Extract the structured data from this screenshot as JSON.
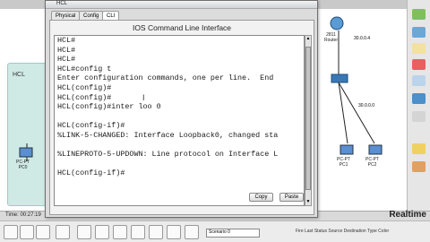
{
  "window": {
    "title": "HCL",
    "tabs": [
      "Physical",
      "Config",
      "CLI"
    ],
    "active_tab": "CLI",
    "cli_title": "IOS Command Line Interface",
    "terminal_lines": [
      "HCL#",
      "HCL#",
      "HCL#",
      "HCL#config t",
      "Enter configuration commands, one per line.  End",
      "HCL(config)#",
      "HCL(config)#",
      "HCL(config)#inter loo 0",
      "",
      "HCL(config-if)#",
      "%LINK-5-CHANGED: Interface Loopback0, changed sta",
      "",
      "%LINEPROTO-5-UPDOWN: Line protocol on Interface L",
      "",
      "HCL(config-if)#"
    ],
    "copy_label": "Copy",
    "paste_label": "Paste"
  },
  "workspace": {
    "cloud_label": "HCL",
    "devices": [
      {
        "name": "PC-PT",
        "sub": "PC0"
      },
      {
        "name": "Switch",
        "sub": ""
      },
      {
        "name": "PC-PT",
        "sub": "PC1"
      },
      {
        "name": "PC-PT",
        "sub": "PC2"
      }
    ],
    "router_label": "2811",
    "router_sub": "Router",
    "ip_label_1": "30.0.0.4",
    "ip_label_2": "30.0.0.0"
  },
  "status": {
    "timer": "Time: 00:27:19",
    "mode": "Realtime",
    "scenario": "Scenario 0",
    "pdu_header": "Fire  Last Status  Source  Destination  Type  Color"
  },
  "colors": {
    "terminal_bg": "#ffffff",
    "cloud": "#cfe9e4",
    "toolbar": "#e6e6e6"
  }
}
